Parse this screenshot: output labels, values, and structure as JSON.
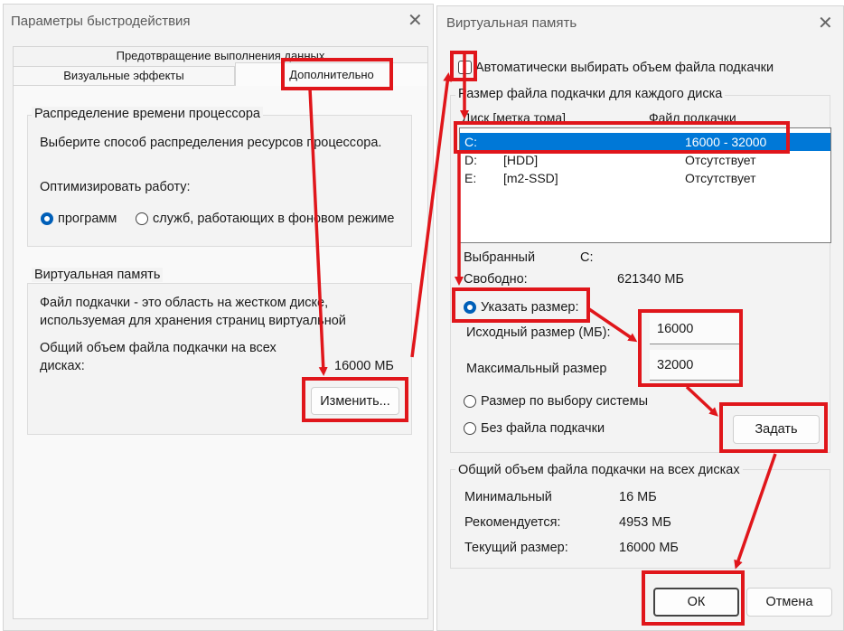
{
  "perf_window": {
    "title": "Параметры быстродействия",
    "tab_top": "Предотвращение выполнения данных",
    "tab_visual": "Визуальные эффекты",
    "tab_advanced": "Дополнительно",
    "cpu_group": {
      "legend": "Распределение времени процессора",
      "desc": "Выберите способ распределения ресурсов процессора.",
      "optimize_label": "Оптимизировать работу:",
      "radio_programs": "программ",
      "radio_services": "служб, работающих в фоновом режиме"
    },
    "vm_group": {
      "legend": "Виртуальная память",
      "desc_line1": "Файл подкачки - это область на жестком диске,",
      "desc_line2": "используемая для хранения страниц виртуальной",
      "total_line1": "Общий объем файла подкачки на всех",
      "total_line2": "дисках:",
      "total_value": "16000 МБ",
      "change_button": "Изменить..."
    }
  },
  "vm_window": {
    "title": "Виртуальная память",
    "auto_checkbox_label": "Автоматически выбирать объем файла подкачки",
    "auto_checked": false,
    "per_disk_group": {
      "legend": "Размер файла подкачки для каждого диска",
      "col_disk": "Диск [метка тома]",
      "col_file": "Файл подкачки",
      "drives": [
        {
          "letter": "C:",
          "label": "",
          "size": "16000 - 32000",
          "selected": true
        },
        {
          "letter": "D:",
          "label": "[HDD]",
          "size": "Отсутствует",
          "selected": false
        },
        {
          "letter": "E:",
          "label": "[m2-SSD]",
          "size": "Отсутствует",
          "selected": false
        }
      ],
      "selected_label": "Выбранный",
      "selected_value": "C:",
      "free_label": "Свободно:",
      "free_value": "621340 МБ",
      "radio_custom": "Указать размер:",
      "initial_label": "Исходный размер (МБ):",
      "initial_value": "16000",
      "max_label": "Максимальный размер",
      "max_value": "32000",
      "radio_system": "Размер по выбору системы",
      "radio_none": "Без файла подкачки",
      "set_button": "Задать"
    },
    "total_group": {
      "legend": "Общий объем файла подкачки на всех дисках",
      "min_label": "Минимальный",
      "min_value": "16 МБ",
      "rec_label": "Рекомендуется:",
      "rec_value": "4953 МБ",
      "cur_label": "Текущий размер:",
      "cur_value": "16000 МБ"
    },
    "ok_button": "ОК",
    "cancel_button": "Отмена"
  },
  "colors": {
    "annotation": "#e0161b",
    "accent": "#005fb8",
    "selection": "#0078d7"
  }
}
